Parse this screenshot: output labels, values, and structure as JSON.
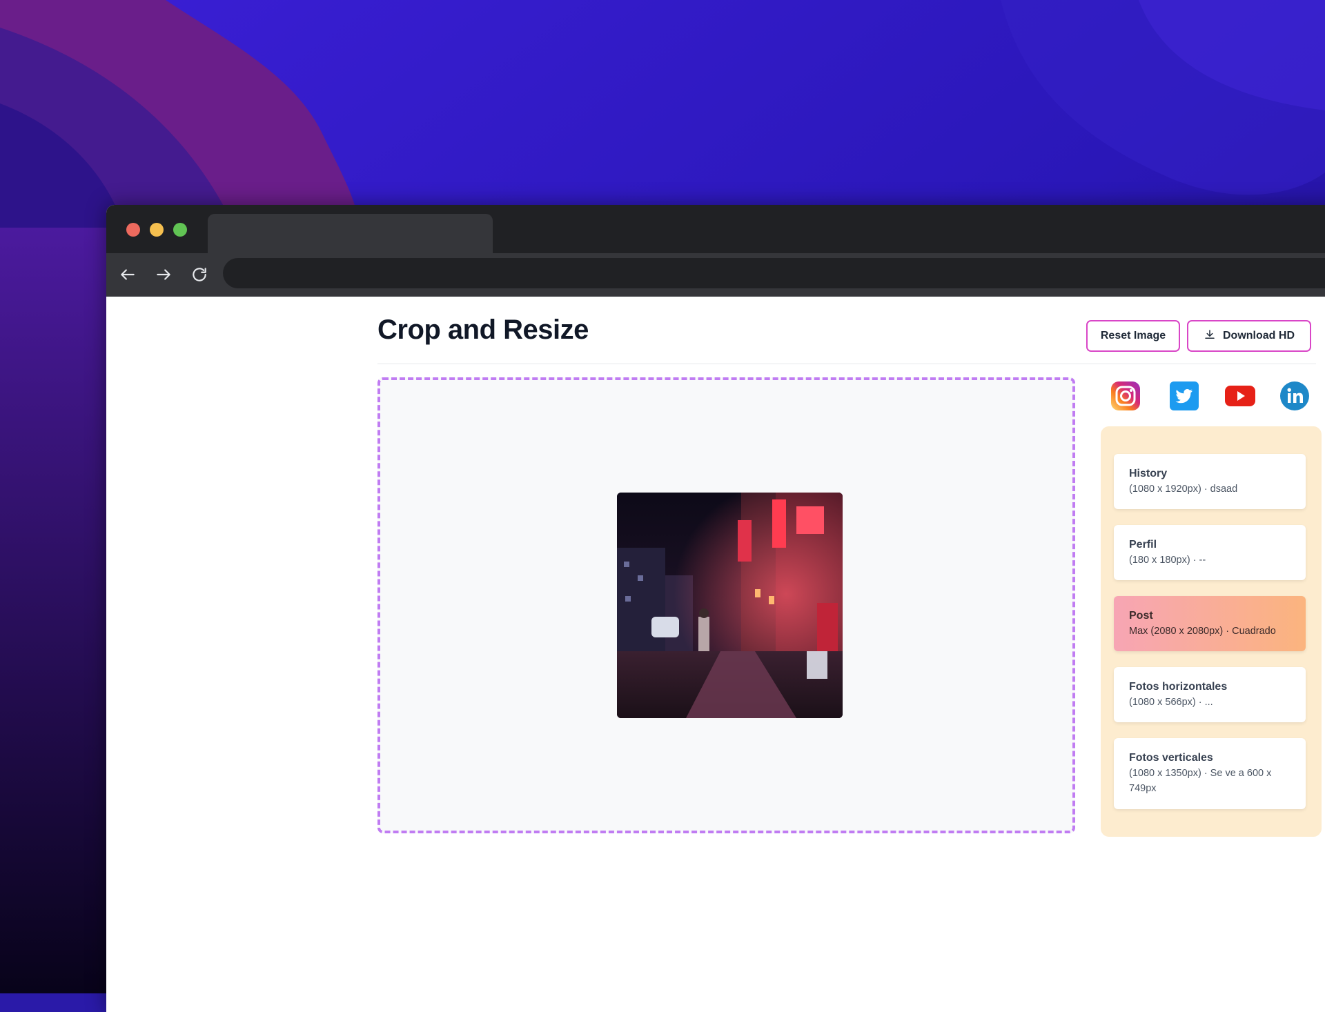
{
  "page": {
    "title": "Crop and Resize",
    "reset_label": "Reset Image",
    "download_label": "Download HD"
  },
  "socials": [
    {
      "name": "instagram-icon",
      "color": "#e1306c"
    },
    {
      "name": "twitter-icon",
      "color": "#1da1f2"
    },
    {
      "name": "youtube-icon",
      "color": "#ff0000"
    },
    {
      "name": "linkedin-icon",
      "color": "#0a66c2"
    }
  ],
  "presets": [
    {
      "name": "History",
      "desc": "(1080 x 1920px) · dsaad",
      "active": false
    },
    {
      "name": "Perfil",
      "desc": "(180 x 180px) · --",
      "active": false
    },
    {
      "name": "Post",
      "desc": "Max (2080 x 2080px) · Cuadrado",
      "active": true
    },
    {
      "name": "Fotos horizontales",
      "desc": "(1080 x 566px) · ...",
      "active": false
    },
    {
      "name": "Fotos verticales",
      "desc": "(1080 x 1350px) · Se ve a 600 x 749px",
      "active": false
    }
  ],
  "colors": {
    "accent_border": "#d946c7",
    "dashed_border": "#c07cf2",
    "panel_bg": "#fdeccf"
  }
}
